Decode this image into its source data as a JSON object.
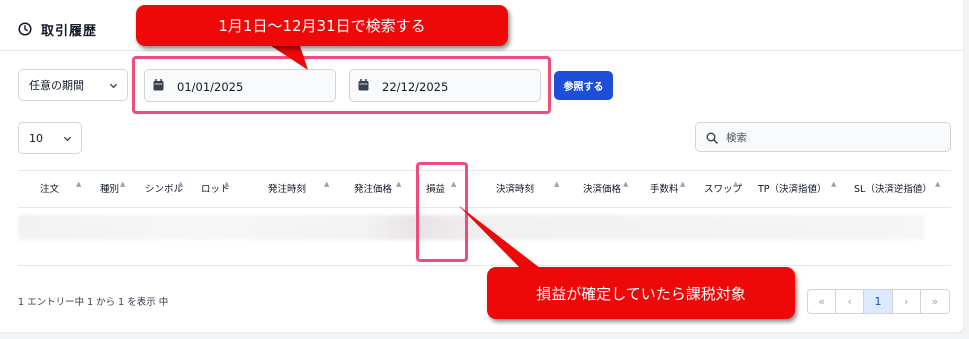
{
  "header": {
    "title": "取引履歴",
    "icon": "clock-icon"
  },
  "filters": {
    "period_select": "任意の期間",
    "date_from": "01/01/2025",
    "date_to": "22/12/2025",
    "view_button": "参照する",
    "page_length": "10",
    "search_placeholder": "検索"
  },
  "table": {
    "columns": [
      "注文",
      "種別",
      "シンボル",
      "ロット",
      "発注時刻",
      "発注価格",
      "損益",
      "決済時刻",
      "決済価格",
      "手数料",
      "スワップ",
      "TP（決済指値）",
      "SL（決済逆指値）"
    ]
  },
  "footer": {
    "info": "1 エントリー中 1 から 1 を表示 中",
    "pagination": [
      "«",
      "‹",
      "1",
      "›",
      "»"
    ],
    "current_page": "1"
  },
  "annotations": {
    "callout_top": "1月1日～12月31日で検索する",
    "callout_bottom": "損益が確定していたら課税対象"
  },
  "colors": {
    "accent": "#1d4ed8",
    "highlight": "#ec4d7a",
    "callout": "#ee0808"
  }
}
